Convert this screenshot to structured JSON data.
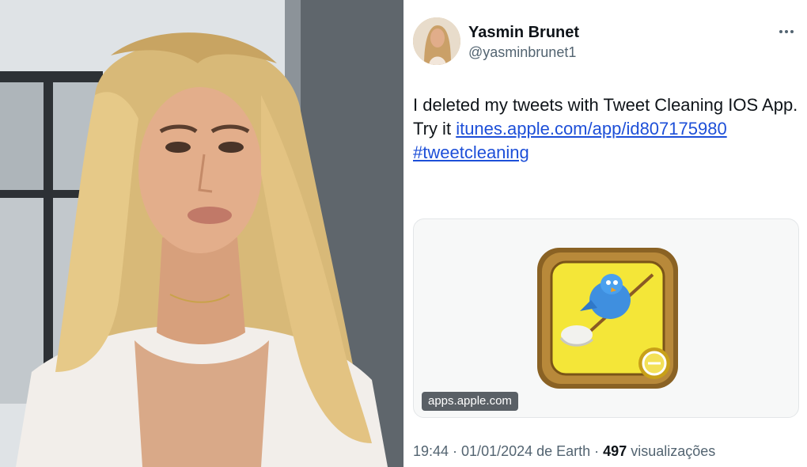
{
  "photo": {
    "alt_icon": "portrait-photo"
  },
  "tweet": {
    "author": {
      "display_name": "Yasmin Brunet",
      "handle": "@yasminbrunet1"
    },
    "text_prefix": "I deleted my tweets with Tweet Cleaning IOS App. Try it ",
    "link_text": "itunes.apple.com/app/id807175980",
    "hashtag": "#tweetcleaning",
    "card": {
      "domain": "apps.apple.com",
      "icon": "tweet-cleaning-app-icon"
    },
    "meta": {
      "time_date": "19:44 · 01/01/2024 de Earth · ",
      "views_count": "497",
      "views_label": " visualizações"
    }
  },
  "colors": {
    "link": "#1d4fd8",
    "secondary_text": "#536471",
    "primary_text": "#0f1419",
    "app_yellow": "#f4e638",
    "app_frame": "#a67b2c"
  }
}
